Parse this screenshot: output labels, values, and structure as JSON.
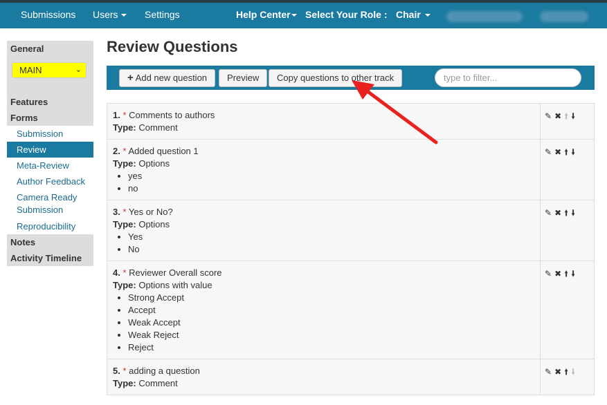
{
  "nav": {
    "submissions": "Submissions",
    "users": "Users",
    "settings": "Settings",
    "help_center": "Help Center",
    "select_role": "Select Your Role :",
    "role": "Chair"
  },
  "sidebar": {
    "general": "General",
    "track_value": "MAIN",
    "features": "Features",
    "forms": "Forms",
    "items": [
      {
        "label": "Submission",
        "active": false
      },
      {
        "label": "Review",
        "active": true
      },
      {
        "label": "Meta-Review",
        "active": false
      },
      {
        "label": "Author Feedback",
        "active": false
      },
      {
        "label": "Camera Ready Submission",
        "active": false
      },
      {
        "label": "Reproducibility",
        "active": false
      }
    ],
    "notes": "Notes",
    "activity_timeline": "Activity Timeline"
  },
  "page": {
    "title": "Review Questions"
  },
  "toolbar": {
    "add_label": "Add new question",
    "add_icon": "+",
    "preview_label": "Preview",
    "copy_label": "Copy questions to other track",
    "filter_placeholder": "type to filter..."
  },
  "questions": [
    {
      "num": "1.",
      "title": "Comments to authors",
      "type_label": "Type:",
      "type": "Comment",
      "options": []
    },
    {
      "num": "2.",
      "title": "Added question 1",
      "type_label": "Type:",
      "type": "Options",
      "options": [
        "yes",
        "no"
      ]
    },
    {
      "num": "3.",
      "title": "Yes or No?",
      "type_label": "Type:",
      "type": "Options",
      "options": [
        "Yes",
        "No"
      ]
    },
    {
      "num": "4.",
      "title": "Reviewer Overall score",
      "type_label": "Type:",
      "type": "Options with value",
      "options": [
        "Strong Accept",
        "Accept",
        "Weak Accept",
        "Weak Reject",
        "Reject"
      ]
    },
    {
      "num": "5.",
      "title": "adding a question",
      "type_label": "Type:",
      "type": "Comment",
      "options": []
    }
  ],
  "colors": {
    "nav": "#1a7a9f",
    "highlight": "#ffff00",
    "annotation_arrow": "#e8231f"
  }
}
